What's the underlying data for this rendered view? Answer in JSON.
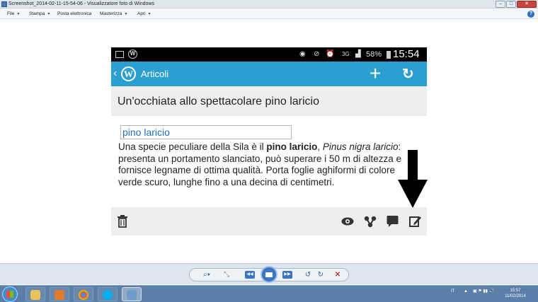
{
  "window": {
    "title": "Screenshot_2014-02-11-15-54-06 - Visualizzatore foto di Windows",
    "minimize": "–",
    "maximize": "□",
    "close": "✕"
  },
  "menu": {
    "items": [
      "File",
      "Stampa",
      "Posta elettronica",
      "Masterizza",
      "Apri"
    ],
    "help": "?"
  },
  "phone": {
    "status": {
      "network": "3G",
      "battery": "58%",
      "time": "15:54"
    },
    "action_bar": {
      "title": "Articoli",
      "logo": "W",
      "back": "‹",
      "add": "+",
      "refresh": "↻"
    },
    "post": {
      "title": "Un'occhiata allo spettacolare pino laricio",
      "tag_field": "pino laricio",
      "body": {
        "part1": "Una specie peculiare della Sila è il ",
        "bold": "pino laricio",
        "part2": ", ",
        "italic": "Pinus nigra laricio",
        "part3": ": presenta un portamento slanciato, può superare i 50 m di altezza e fornisce legname di ottima qualità. Porta foglie aghiformi di colore verde scuro, lunghe fino a una decina di centimetri."
      }
    },
    "bottom_icons": [
      "trash-icon",
      "eye-icon",
      "share-icon",
      "comment-icon",
      "edit-icon"
    ]
  },
  "taskbar": {
    "language": "IT",
    "time": "15:57",
    "date": "11/02/2014"
  },
  "colors": {
    "accent": "#2ba0d0",
    "statusbar": "#000000",
    "link": "#1f6fb8"
  }
}
